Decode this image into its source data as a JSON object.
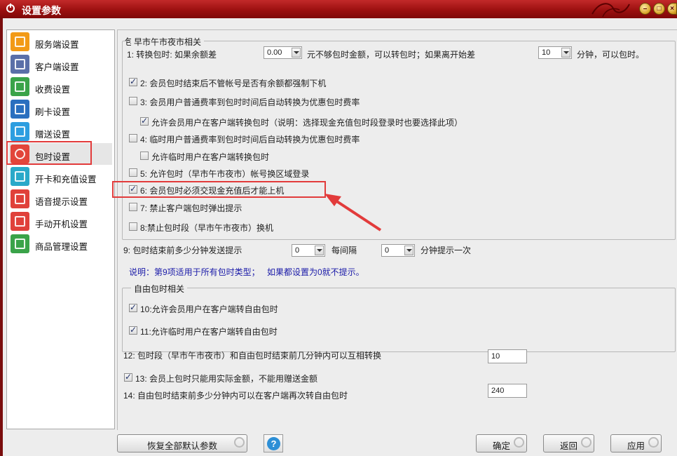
{
  "window": {
    "title": "设置参数",
    "minimize": "–",
    "maximize": "□",
    "close": "×"
  },
  "sidebar": {
    "items": [
      {
        "label": "服务端设置",
        "icon": "server-monitor-icon",
        "color": "#f29a17"
      },
      {
        "label": "客户端设置",
        "icon": "client-monitor-icon",
        "color": "#5a6fa8"
      },
      {
        "label": "收费设置",
        "icon": "clock-coin-icon",
        "color": "#3aa349"
      },
      {
        "label": "刷卡设置",
        "icon": "card-icon",
        "color": "#2a6fbf"
      },
      {
        "label": "赠送设置",
        "icon": "gift-icon",
        "color": "#2d9ee0"
      },
      {
        "label": "包时设置",
        "icon": "clock-icon",
        "color": "#e2453a"
      },
      {
        "label": "开卡和充值设置",
        "icon": "id-card-icon",
        "color": "#2aa9c9"
      },
      {
        "label": "语音提示设置",
        "icon": "microphone-icon",
        "color": "#e0413a"
      },
      {
        "label": "手动开机设置",
        "icon": "hand-pointer-icon",
        "color": "#e0413a"
      },
      {
        "label": "商品管理设置",
        "icon": "shopping-cart-icon",
        "color": "#3aa349"
      }
    ]
  },
  "main": {
    "group_title": "包时设置",
    "early_section": {
      "legend": "早市午市夜市相关",
      "row1": {
        "prefix": "1: 转换包时: 如果余额差",
        "combo1": "0.00",
        "mid": "元不够包时金额，可以转包时；如果离开始差",
        "combo2": "10",
        "suffix": "分钟，可以包时。"
      },
      "options": [
        {
          "label": "2: 会员包时结束后不管帐号是否有余额都强制下机",
          "checked": true
        },
        {
          "label": "3: 会员用户普通费率到包时时间后自动转换为优惠包时费率",
          "checked": false
        },
        {
          "label": "允许会员用户在客户端转换包时（说明：选择现金充值包时段登录时也要选择此项）",
          "checked": true
        },
        {
          "label": "4: 临时用户普通费率到包时时间后自动转换为优惠包时费率",
          "checked": false
        },
        {
          "label": "允许临时用户在客户端转换包时",
          "checked": false
        },
        {
          "label": "5: 允许包时（早市午市夜市）帐号换区域登录",
          "checked": false
        },
        {
          "label": "6: 会员包时必须交现金充值后才能上机",
          "checked": true
        },
        {
          "label": "7: 禁止客户端包时弹出提示",
          "checked": false
        },
        {
          "label": "8:禁止包时段（早市午市夜市）换机",
          "checked": false
        }
      ]
    },
    "row9": {
      "prefix": "9: 包时结束前多少分钟发送提示",
      "combo1": "0",
      "mid": "每间隔",
      "combo2": "0",
      "suffix": "分钟提示一次"
    },
    "note": {
      "left": "说明：第9项适用于所有包时类型；",
      "right": "如果都设置为0就不提示。"
    },
    "free_section": {
      "legend": "自由包时相关",
      "options": [
        {
          "label": "10:允许会员用户在客户端转自由包时",
          "checked": true
        },
        {
          "label": "11:允许临时用户在客户端转自由包时",
          "checked": true
        }
      ]
    },
    "row12": {
      "label": "12: 包时段（早市午市夜市）和自由包时结束前几分钟内可以互相转换",
      "value": "10"
    },
    "row13": {
      "label": "13: 会员上包时只能用实际金额，不能用赠送金额",
      "checked": true
    },
    "row14": {
      "label": "14: 自由包时结束前多少分钟内可以在客户端再次转自由包时",
      "value": "240"
    }
  },
  "buttons": {
    "restore": "恢复全部默认参数",
    "help": "?",
    "ok": "确定",
    "back": "返回",
    "apply": "应用"
  },
  "colors": {
    "titlebar": "#9c1010",
    "annotation": "#e23b3b"
  }
}
